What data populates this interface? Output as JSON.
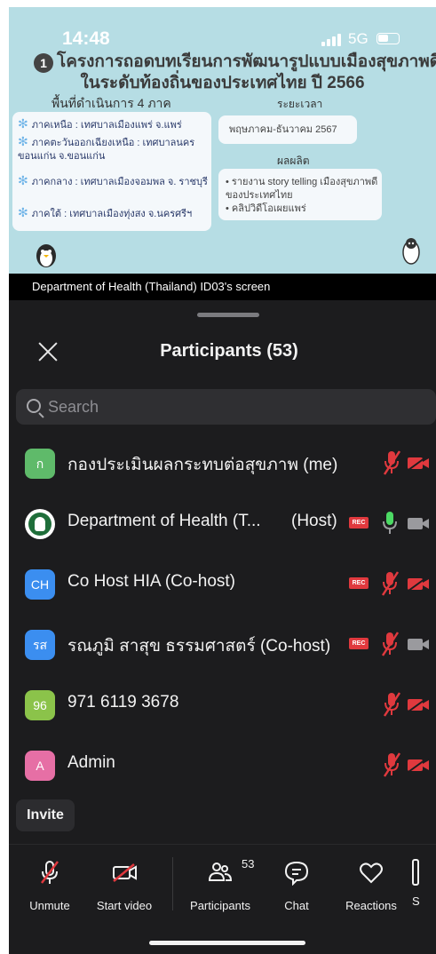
{
  "status_bar": {
    "time": "14:48",
    "network": "5G"
  },
  "shared_screen": {
    "title_number": "1",
    "title_line1": "โครงการถอดบทเรียนการพัฒนารูปแบบเมืองสุขภาพดี",
    "title_line2": "ในระดับท้องถิ่นของประเทศไทย ปี 2566",
    "areas_heading": "พื้นที่ดำเนินการ 4 ภาค",
    "areas": [
      "ภาคเหนือ : เทศบาลเมืองแพร่ จ.แพร่",
      "ภาคตะวันออกเฉียงเหนือ : เทศบาลนคร ขอนแก่น จ.ขอนแก่น",
      "ภาคกลาง : เทศบาลเมืองจอมพล จ. ราชบุรี",
      "ภาคใต้ : เทศบาลเมืองทุ่งสง จ.นครศรีฯ"
    ],
    "period_heading": "ระยะเวลา",
    "period": "พฤษภาคม-ธันวาคม 2567",
    "output_heading": "ผลผลิต",
    "outputs": [
      "• รายงาน story telling เมืองสุขภาพดี ของประเทศไทย",
      "• คลิปวิดีโอเผยแพร่"
    ]
  },
  "share_label": "Department of Health (Thailand) ID03's screen",
  "panel": {
    "title": "Participants (53)",
    "search_placeholder": "Search",
    "participants": [
      {
        "initials": "ก",
        "color": "#5fba6a",
        "name": "กองประเมินผลกระทบต่อสุขภาพ (me)",
        "role": "",
        "rec": false,
        "mic": "muted",
        "cam": "off"
      },
      {
        "initials": "",
        "color": "#ffffff",
        "name": "Department of Health (T...",
        "role": "(Host)",
        "rec": true,
        "mic": "on",
        "cam": "on"
      },
      {
        "initials": "CH",
        "color": "#3b8ef0",
        "name": "Co Host HIA (Co-host)",
        "role": "",
        "rec": true,
        "mic": "muted",
        "cam": "off"
      },
      {
        "initials": "รส",
        "color": "#3b8ef0",
        "name": "รณภูมิ สาสุข ธรรมศาสตร์ (Co-host)",
        "role": "",
        "rec": true,
        "mic": "muted",
        "cam": "on"
      },
      {
        "initials": "96",
        "color": "#8bc34a",
        "name": "971 6119 3678",
        "role": "",
        "rec": false,
        "mic": "muted",
        "cam": "off"
      },
      {
        "initials": "A",
        "color": "#e66fa5",
        "name": "Admin",
        "role": "",
        "rec": false,
        "mic": "muted",
        "cam": "off"
      }
    ],
    "rec_label": "REC",
    "invite_label": "Invite"
  },
  "toolbar": {
    "unmute": "Unmute",
    "start_video": "Start video",
    "participants": "Participants",
    "participants_count": "53",
    "chat": "Chat",
    "reactions": "Reactions",
    "more_partial": "S"
  },
  "colors": {
    "muted_red": "#e0393e",
    "mic_green": "#4cd964",
    "sheet_bg": "#1c1c1e"
  }
}
